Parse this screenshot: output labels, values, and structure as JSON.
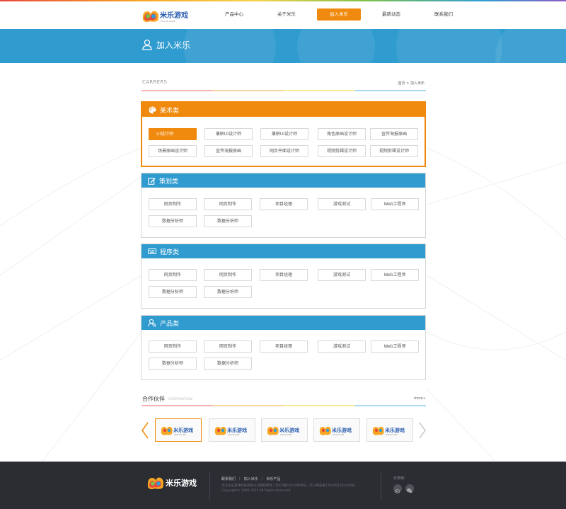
{
  "nav": {
    "items": [
      {
        "label": "产品中心"
      },
      {
        "label": "关于米乐"
      },
      {
        "label": "加入米乐",
        "active": true
      },
      {
        "label": "最新动态"
      },
      {
        "label": "联系我们"
      }
    ]
  },
  "banner": {
    "title": "加入米乐"
  },
  "section": {
    "title": "CARRERS",
    "breadcrumb": "首页 > 加入米乐"
  },
  "categories": [
    {
      "title": "美术类",
      "icon": "palette-icon",
      "jobs": [
        "UI设计师",
        "兼职UI设计师",
        "兼职UI设计师",
        "角色原画设计师",
        "宣传海报原画",
        "场景原画设计师",
        "宣传海报原画",
        "网页平面设计师",
        "视频剪辑设计师",
        "视频剪辑设计师"
      ]
    },
    {
      "title": "策划类",
      "icon": "edit-icon",
      "jobs": [
        "网页制作",
        "网页制作",
        "项目经理",
        "游戏测试",
        "Web工程师",
        "数据分析师",
        "数据分析师"
      ]
    },
    {
      "title": "程序类",
      "icon": "keyboard-icon",
      "jobs": [
        "网页制作",
        "网页制作",
        "项目经理",
        "游戏测试",
        "Web工程师",
        "数据分析师",
        "数据分析师"
      ]
    },
    {
      "title": "产品类",
      "icon": "user-search-icon",
      "jobs": [
        "网页制作",
        "网页制作",
        "项目经理",
        "游戏测试",
        "Web工程师",
        "数据分析师",
        "数据分析师"
      ]
    }
  ],
  "partners": {
    "title": "合作伙伴",
    "subtitle": "CORPORATION",
    "more": "more+",
    "logo_text": "米乐游戏",
    "logo_subtext": "MILLER GAME"
  },
  "footer": {
    "links": [
      "联系我们",
      "加入米乐",
      "米乐产品"
    ],
    "line1": "北京米乐游戏科技有限公司版权所有 | 京ICP备10210809号 | 京公网安备1101081201440号",
    "line2": "Copyright© 2009-2015 All Rights Reserved",
    "share_label": "分享到:"
  },
  "colors": {
    "accent": "#f08a0e",
    "primary": "#2f9bcf",
    "footer_bg": "#2b2d33"
  }
}
